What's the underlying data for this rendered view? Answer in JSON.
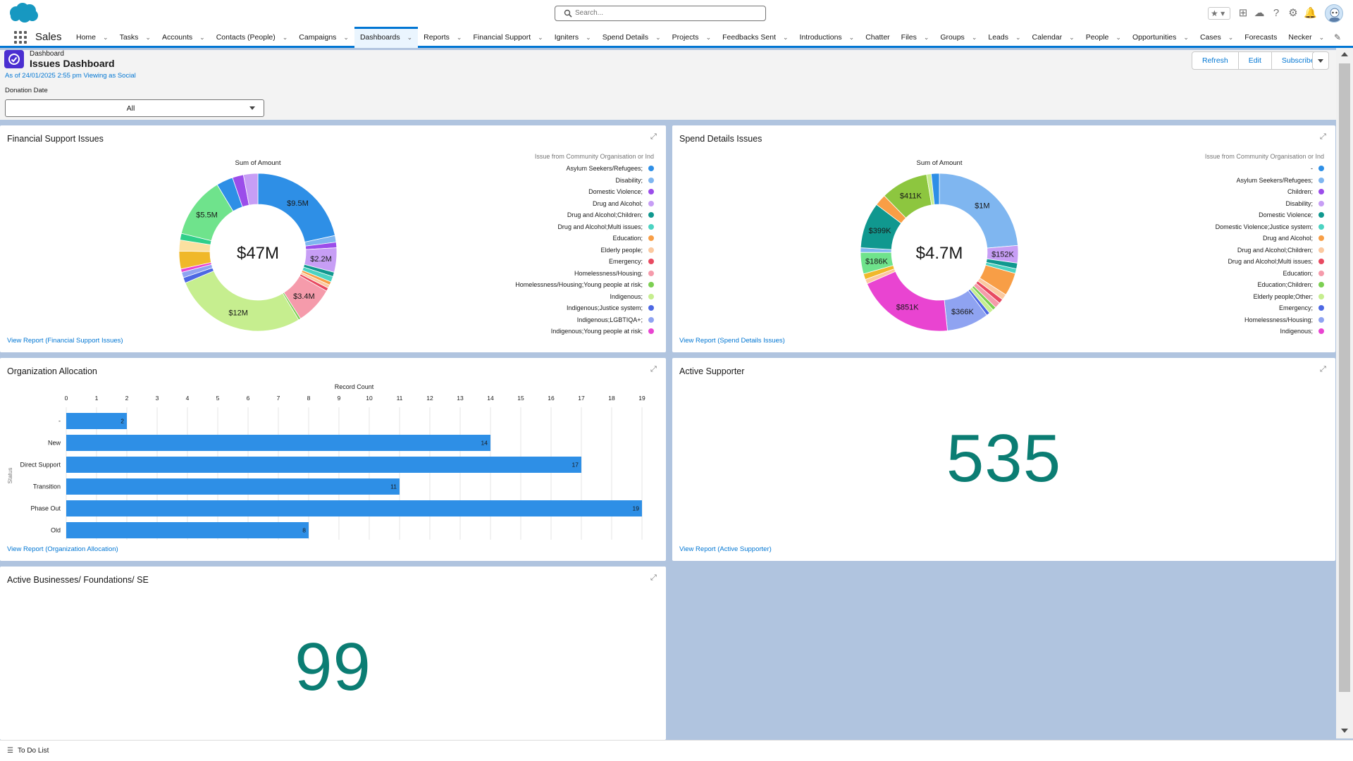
{
  "app": {
    "name": "Sales",
    "search_placeholder": "Search...",
    "fav_glyph": "★",
    "nav_items": [
      "Home",
      "Tasks",
      "Accounts",
      "Contacts (People)",
      "Campaigns",
      "Dashboards",
      "Reports",
      "Financial Support",
      "Igniters",
      "Spend Details",
      "Projects",
      "Feedbacks Sent",
      "Introductions",
      "Chatter",
      "Files",
      "Groups",
      "Leads",
      "Calendar",
      "People",
      "Opportunities",
      "Cases",
      "Forecasts",
      "Necker"
    ],
    "nav_with_chevron": [
      true,
      true,
      true,
      true,
      true,
      true,
      true,
      true,
      true,
      true,
      true,
      true,
      true,
      false,
      true,
      true,
      true,
      true,
      true,
      true,
      true,
      false,
      true
    ],
    "active_nav": "Dashboards",
    "icons": [
      "salesforce-logo",
      "search-icon",
      "favorites-star-icon",
      "add-icon",
      "trailhead-icon",
      "help-icon",
      "gear-icon",
      "bell-icon",
      "avatar",
      "app-launcher-icon",
      "pencil-icon"
    ]
  },
  "dashboard": {
    "type_label": "Dashboard",
    "title": "Issues Dashboard",
    "as_of": "As of 24/01/2025 2:55 pm Viewing as Social",
    "filter_label": "Donation Date",
    "filter_value": "All",
    "buttons": {
      "refresh": "Refresh",
      "edit": "Edit",
      "subscribe": "Subscribe"
    }
  },
  "cards": {
    "financial_support": {
      "title": "Financial Support Issues",
      "link": "View Report (Financial Support Issues)",
      "measure_title": "Sum of Amount",
      "total": "$47M",
      "legend_title": "Issue from Community Organisation or Ind",
      "legend": [
        {
          "label": "Asylum Seekers/Refugees;",
          "color": "#2e8fe6"
        },
        {
          "label": "Disability;",
          "color": "#7fb6f0"
        },
        {
          "label": "Domestic Violence;",
          "color": "#9b4dea"
        },
        {
          "label": "Drug and Alcohol;",
          "color": "#c79ef5"
        },
        {
          "label": "Drug and Alcohol;Children;",
          "color": "#10988f"
        },
        {
          "label": "Drug and Alcohol;Multi issues;",
          "color": "#4cd3c2"
        },
        {
          "label": "Education;",
          "color": "#f89e46"
        },
        {
          "label": "Elderly people;",
          "color": "#fbc9a0"
        },
        {
          "label": "Emergency;",
          "color": "#e84a61"
        },
        {
          "label": "Homelessness/Housing;",
          "color": "#f59bab"
        },
        {
          "label": "Homelessness/Housing;Young people at risk;",
          "color": "#7ccf52"
        },
        {
          "label": "Indigenous;",
          "color": "#c6ee8f"
        },
        {
          "label": "Indigenous;Justice system;",
          "color": "#4d68e3"
        },
        {
          "label": "Indigenous;LGBTIQA+;",
          "color": "#8fa3f1"
        },
        {
          "label": "Indigenous;Young people at risk;",
          "color": "#e944d1"
        }
      ]
    },
    "spend_details": {
      "title": "Spend Details Issues",
      "link": "View Report (Spend Details Issues)",
      "measure_title": "Sum of Amount",
      "total": "$4.7M",
      "legend_title": "Issue from Community Organisation or Ind",
      "legend": [
        {
          "label": "-",
          "color": "#2e8fe6"
        },
        {
          "label": "Asylum Seekers/Refugees;",
          "color": "#7fb6f0"
        },
        {
          "label": "Children;",
          "color": "#9b4dea"
        },
        {
          "label": "Disability;",
          "color": "#c79ef5"
        },
        {
          "label": "Domestic Violence;",
          "color": "#10988f"
        },
        {
          "label": "Domestic Violence;Justice system;",
          "color": "#4cd3c2"
        },
        {
          "label": "Drug and Alcohol;",
          "color": "#f89e46"
        },
        {
          "label": "Drug and Alcohol;Children;",
          "color": "#fbc9a0"
        },
        {
          "label": "Drug and Alcohol;Multi issues;",
          "color": "#e84a61"
        },
        {
          "label": "Education;",
          "color": "#f59bab"
        },
        {
          "label": "Education;Children;",
          "color": "#7ccf52"
        },
        {
          "label": "Elderly people;Other;",
          "color": "#c6ee8f"
        },
        {
          "label": "Emergency;",
          "color": "#4d68e3"
        },
        {
          "label": "Homelessness/Housing;",
          "color": "#8fa3f1"
        },
        {
          "label": "Indigenous;",
          "color": "#e944d1"
        }
      ]
    },
    "organization_allocation": {
      "title": "Organization Allocation",
      "link": "View Report (Organization Allocation)"
    },
    "active_supporter": {
      "title": "Active Supporter",
      "value": "535",
      "link": "View Report (Active Supporter)"
    },
    "active_businesses": {
      "title": "Active Businesses/ Foundations/ SE",
      "value": "99"
    }
  },
  "chart_data": [
    {
      "type": "pie",
      "title": "Sum of Amount",
      "center_label": "$47M",
      "legend_title": "Issue from Community Organisation or Ind",
      "slices": [
        {
          "color": "#2e8fe6",
          "value": 9.5,
          "label": "$9.5M"
        },
        {
          "color": "#7fb6f0",
          "value": 0.6,
          "label": ""
        },
        {
          "color": "#9b4dea",
          "value": 0.5,
          "label": ""
        },
        {
          "color": "#c79ef5",
          "value": 2.2,
          "label": "$2.2M"
        },
        {
          "color": "#10988f",
          "value": 0.4,
          "label": ""
        },
        {
          "color": "#4cd3c2",
          "value": 0.5,
          "label": ""
        },
        {
          "color": "#f89e46",
          "value": 0.3,
          "label": ""
        },
        {
          "color": "#fbc9a0",
          "value": 0.3,
          "label": ""
        },
        {
          "color": "#e84a61",
          "value": 0.3,
          "label": ""
        },
        {
          "color": "#f59bab",
          "value": 3.4,
          "label": "$3.4M"
        },
        {
          "color": "#7ccf52",
          "value": 0.2,
          "label": ""
        },
        {
          "color": "#c6ee8f",
          "value": 12,
          "label": "$12M"
        },
        {
          "color": "#4d68e3",
          "value": 0.5,
          "label": ""
        },
        {
          "color": "#8fa3f1",
          "value": 0.5,
          "label": ""
        },
        {
          "color": "#e944d1",
          "value": 0.3,
          "label": ""
        },
        {
          "color": "#f0b82a",
          "value": 1.6,
          "label": ""
        },
        {
          "color": "#fbe0a0",
          "value": 1.0,
          "label": ""
        },
        {
          "color": "#2fcf8a",
          "value": 0.6,
          "label": ""
        },
        {
          "color": "#6fe38c",
          "value": 5.5,
          "label": "$5.5M"
        },
        {
          "color": "#2e8fe6",
          "value": 1.5,
          "label": ""
        },
        {
          "color": "#9b4dea",
          "value": 1.0,
          "label": ""
        },
        {
          "color": "#c79ef5",
          "value": 1.3,
          "label": ""
        }
      ]
    },
    {
      "type": "pie",
      "title": "Sum of Amount",
      "center_label": "$4.7M",
      "legend_title": "Issue from Community Organisation or Ind",
      "slices": [
        {
          "color": "#7fb6f0",
          "value": 1.0,
          "label": "$1M"
        },
        {
          "color": "#c79ef5",
          "value": 0.152,
          "label": "$152K"
        },
        {
          "color": "#10988f",
          "value": 0.05,
          "label": ""
        },
        {
          "color": "#4cd3c2",
          "value": 0.04,
          "label": ""
        },
        {
          "color": "#f89e46",
          "value": 0.2,
          "label": ""
        },
        {
          "color": "#fbc9a0",
          "value": 0.05,
          "label": ""
        },
        {
          "color": "#e84a61",
          "value": 0.04,
          "label": ""
        },
        {
          "color": "#f59bab",
          "value": 0.05,
          "label": ""
        },
        {
          "color": "#7ccf52",
          "value": 0.03,
          "label": ""
        },
        {
          "color": "#c6ee8f",
          "value": 0.04,
          "label": ""
        },
        {
          "color": "#4d68e3",
          "value": 0.03,
          "label": ""
        },
        {
          "color": "#8fa3f1",
          "value": 0.366,
          "label": "$366K"
        },
        {
          "color": "#e944d1",
          "value": 0.851,
          "label": "$851K"
        },
        {
          "color": "#fbc9a0",
          "value": 0.04,
          "label": ""
        },
        {
          "color": "#f0b82a",
          "value": 0.05,
          "label": ""
        },
        {
          "color": "#6fe38c",
          "value": 0.186,
          "label": "$186K"
        },
        {
          "color": "#7fb6f0",
          "value": 0.04,
          "label": ""
        },
        {
          "color": "#10988f",
          "value": 0.399,
          "label": "$399K"
        },
        {
          "color": "#f89e46",
          "value": 0.1,
          "label": ""
        },
        {
          "color": "#8dc63f",
          "value": 0.411,
          "label": "$411K"
        },
        {
          "color": "#c6ee8f",
          "value": 0.04,
          "label": ""
        },
        {
          "color": "#2e8fe6",
          "value": 0.07,
          "label": ""
        }
      ]
    },
    {
      "type": "bar",
      "orientation": "horizontal",
      "title": "Record Count",
      "ylabel": "Status",
      "categories": [
        "-",
        "New",
        "Direct Support",
        "Transition",
        "Phase Out",
        "Old"
      ],
      "values": [
        2,
        14,
        17,
        11,
        19,
        8
      ],
      "xlim": [
        0,
        19
      ],
      "xticks": [
        0,
        1,
        2,
        3,
        4,
        5,
        6,
        7,
        8,
        9,
        10,
        11,
        12,
        13,
        14,
        15,
        16,
        17,
        18,
        19
      ],
      "color": "#2e8fe6",
      "grid": true
    }
  ],
  "footer": {
    "label": "To Do List"
  }
}
